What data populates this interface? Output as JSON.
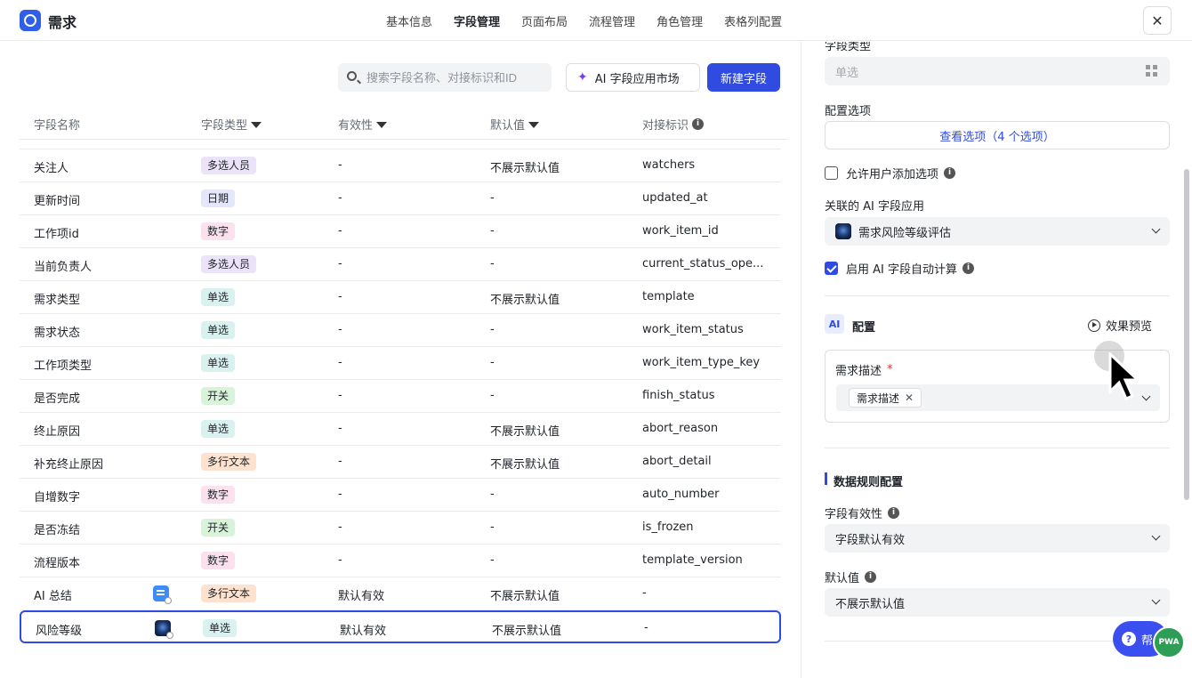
{
  "header": {
    "app_title": "需求",
    "tabs": [
      "基本信息",
      "字段管理",
      "页面布局",
      "流程管理",
      "角色管理",
      "表格列配置"
    ],
    "active_tab": "字段管理",
    "close_symbol": "✕"
  },
  "toolbar": {
    "search_placeholder": "搜索字段名称、对接标识和ID",
    "ai_market_label": "AI 字段应用市场",
    "new_field_label": "新建字段"
  },
  "table": {
    "columns": [
      "字段名称",
      "字段类型",
      "有效性",
      "默认值",
      "对接标识"
    ],
    "rows": [
      {
        "name": "关注人",
        "type": "多选人员",
        "type_color": "#ebe3f8",
        "valid": "-",
        "default": "不展示默认值",
        "key": "watchers"
      },
      {
        "name": "更新时间",
        "type": "日期",
        "type_color": "#e4e6fb",
        "valid": "-",
        "default": "-",
        "key": "updated_at"
      },
      {
        "name": "工作项id",
        "type": "数字",
        "type_color": "#fbe0ee",
        "valid": "-",
        "default": "-",
        "key": "work_item_id"
      },
      {
        "name": "当前负责人",
        "type": "多选人员",
        "type_color": "#ebe3f8",
        "valid": "-",
        "default": "-",
        "key": "current_status_ope..."
      },
      {
        "name": "需求类型",
        "type": "单选",
        "type_color": "#d9f2ef",
        "valid": "-",
        "default": "不展示默认值",
        "key": "template"
      },
      {
        "name": "需求状态",
        "type": "单选",
        "type_color": "#d9f2ef",
        "valid": "-",
        "default": "-",
        "key": "work_item_status"
      },
      {
        "name": "工作项类型",
        "type": "单选",
        "type_color": "#d9f2ef",
        "valid": "-",
        "default": "-",
        "key": "work_item_type_key"
      },
      {
        "name": "是否完成",
        "type": "开关",
        "type_color": "#d8f3da",
        "valid": "-",
        "default": "-",
        "key": "finish_status"
      },
      {
        "name": "终止原因",
        "type": "单选",
        "type_color": "#d9f2ef",
        "valid": "-",
        "default": "不展示默认值",
        "key": "abort_reason"
      },
      {
        "name": "补充终止原因",
        "type": "多行文本",
        "type_color": "#fde3cf",
        "valid": "-",
        "default": "不展示默认值",
        "key": "abort_detail"
      },
      {
        "name": "自增数字",
        "type": "数字",
        "type_color": "#fbe0ee",
        "valid": "-",
        "default": "-",
        "key": "auto_number"
      },
      {
        "name": "是否冻结",
        "type": "开关",
        "type_color": "#d8f3da",
        "valid": "-",
        "default": "-",
        "key": "is_frozen"
      },
      {
        "name": "流程版本",
        "type": "数字",
        "type_color": "#fbe0ee",
        "valid": "-",
        "default": "-",
        "key": "template_version"
      },
      {
        "name": "AI 总结",
        "type": "多行文本",
        "type_color": "#fde3cf",
        "valid": "默认有效",
        "default": "不展示默认值",
        "key": "-",
        "icon": "doc-ai-icon"
      },
      {
        "name": "风险等级",
        "type": "单选",
        "type_color": "#d9f2ef",
        "valid": "默认有效",
        "default": "不展示默认值",
        "key": "-",
        "icon": "image-ai-icon",
        "selected": true
      }
    ]
  },
  "panel": {
    "field_type_label": "字段类型",
    "field_type_value": "单选",
    "config_options_label": "配置选项",
    "view_options_label": "查看选项（4 个选项）",
    "allow_add_label": "允许用户添加选项",
    "allow_add_checked": false,
    "ai_app_label": "关联的 AI 字段应用",
    "ai_app_value": "需求风险等级评估",
    "auto_calc_label": "启用 AI 字段自动计算",
    "auto_calc_checked": true,
    "ai_badge": "AI",
    "config_label": "配置",
    "preview_label": "效果预览",
    "req_desc_label": "需求描述",
    "required_mark": "*",
    "chip_label": "需求描述",
    "data_rules_label": "数据规则配置",
    "validity_label": "字段有效性",
    "validity_value": "字段默认有效",
    "default_label": "默认值",
    "default_value": "不展示默认值"
  },
  "help": {
    "label": "帮",
    "pwa": "PWA"
  }
}
